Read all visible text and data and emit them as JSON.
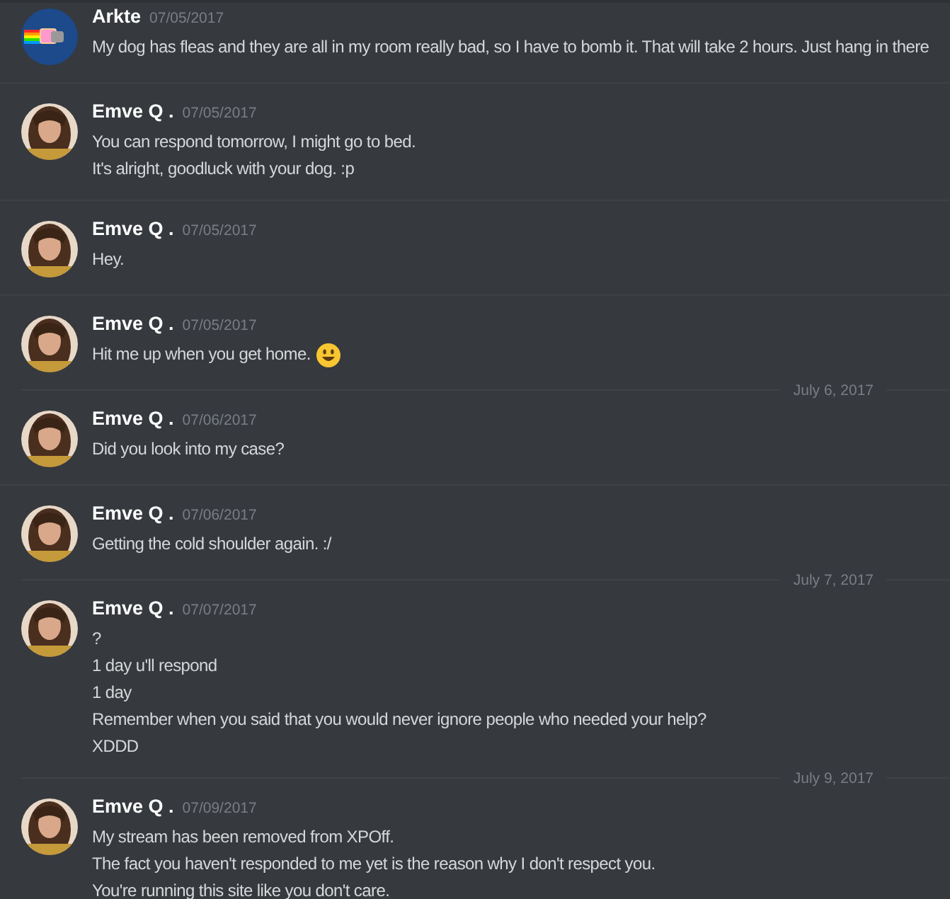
{
  "messages": [
    {
      "kind": "message",
      "author": "Arkte",
      "avatar": {
        "kind": "nyan"
      },
      "date": "07/05/2017",
      "lines": [
        "My dog has fleas and they are all in my room really bad, so I have to bomb it. That will take 2 hours. Just hang in there"
      ]
    },
    {
      "kind": "message",
      "author": "Emve Q .",
      "avatar": {
        "kind": "picture"
      },
      "date": "07/05/2017",
      "lines": [
        "You can respond tomorrow, I might go to bed.",
        "It's alright, goodluck with your dog. :p"
      ]
    },
    {
      "kind": "message",
      "author": "Emve Q .",
      "avatar": {
        "kind": "picture"
      },
      "date": "07/05/2017",
      "lines": [
        "Hey."
      ]
    },
    {
      "kind": "message",
      "author": "Emve Q .",
      "avatar": {
        "kind": "picture"
      },
      "date": "07/05/2017",
      "lines": [
        "Hit me up when you get home."
      ],
      "emoji": true
    },
    {
      "kind": "divider",
      "label": "July 6, 2017"
    },
    {
      "kind": "message",
      "author": "Emve Q .",
      "avatar": {
        "kind": "picture"
      },
      "date": "07/06/2017",
      "lines": [
        "Did you look into my case?"
      ]
    },
    {
      "kind": "message",
      "author": "Emve Q .",
      "avatar": {
        "kind": "picture"
      },
      "date": "07/06/2017",
      "lines": [
        "Getting the cold shoulder again. :/"
      ]
    },
    {
      "kind": "divider",
      "label": "July 7, 2017"
    },
    {
      "kind": "message",
      "author": "Emve Q .",
      "avatar": {
        "kind": "picture"
      },
      "date": "07/07/2017",
      "lines": [
        "?",
        "1 day u'll respond",
        "1 day",
        "Remember when you said that you would never ignore people who needed your help?",
        "XDDD"
      ]
    },
    {
      "kind": "divider",
      "label": "July 9, 2017"
    },
    {
      "kind": "message",
      "author": "Emve Q .",
      "avatar": {
        "kind": "picture"
      },
      "date": "07/09/2017",
      "lines": [
        "My stream has been removed from XPOff.",
        "The fact you haven't responded to me yet is the reason why I don't respect you.",
        "You're running this site like you don't care."
      ]
    }
  ]
}
